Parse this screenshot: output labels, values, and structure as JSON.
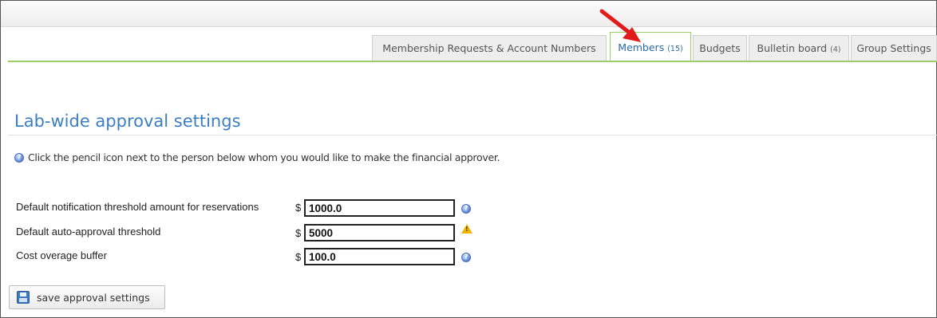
{
  "tabs": [
    {
      "label": "Membership Requests & Account Numbers",
      "count": ""
    },
    {
      "label": "Members",
      "count": "(15)"
    },
    {
      "label": "Budgets",
      "count": ""
    },
    {
      "label": "Bulletin board",
      "count": "(4)"
    },
    {
      "label": "Group Settings",
      "count": ""
    }
  ],
  "active_tab": "Members",
  "section": {
    "title": "Lab-wide approval settings",
    "info": "Click the pencil icon next to the person below whom you would like to make the financial approver."
  },
  "fields": [
    {
      "label": "Default notification threshold amount for reservations",
      "currency": "$",
      "value": "1000.0",
      "icon": "help-icon"
    },
    {
      "label": "Default auto-approval threshold",
      "currency": "$",
      "value": "5000",
      "icon": "warning-icon"
    },
    {
      "label": "Cost overage buffer",
      "currency": "$",
      "value": "100.0",
      "icon": "help-icon"
    }
  ],
  "save_button": {
    "label": "save approval settings",
    "icon": "save-icon"
  },
  "colors": {
    "accent": "#3b7ec3",
    "tab_border": "#9ccd6a",
    "annotation_arrow": "#e21b1b",
    "warning": "#f0b400"
  }
}
